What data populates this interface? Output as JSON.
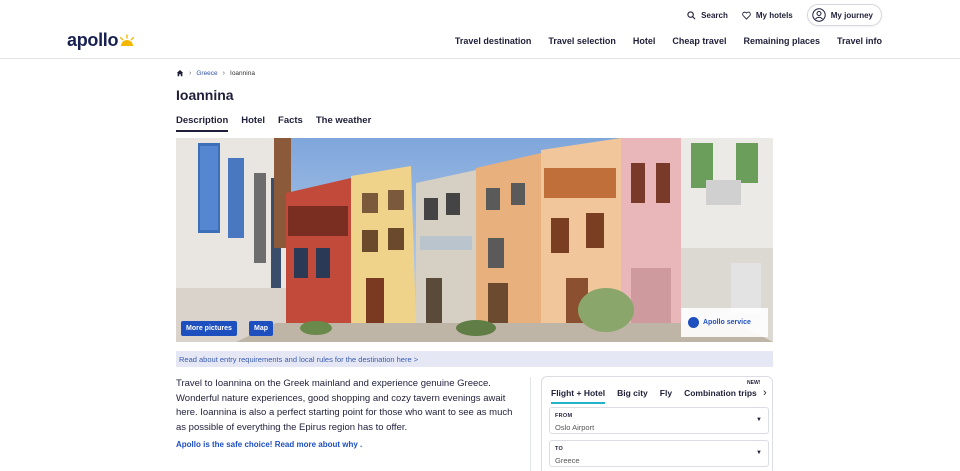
{
  "header": {
    "logo": "apollo",
    "utility": {
      "search": "Search",
      "my_hotels": "My hotels",
      "my_journey": "My journey"
    },
    "nav": [
      "Travel destination",
      "Travel selection",
      "Hotel",
      "Cheap travel",
      "Remaining places",
      "Travel info"
    ]
  },
  "breadcrumb": {
    "parent": "Greece",
    "current": "Ioannina"
  },
  "page_title": "Ioannina",
  "tabs": [
    "Description",
    "Hotel",
    "Facts",
    "The weather"
  ],
  "hero": {
    "more_pictures": "More pictures",
    "map": "Map",
    "service": "Apollo service"
  },
  "entry_banner": "Read about entry requirements and local rules for the destination here >",
  "description": {
    "text": "Travel to Ioannina on the Greek mainland and experience genuine Greece. Wonderful nature experiences, good shopping and cozy tavern evenings await here. Ioannina is also a perfect starting point for those who want to see as much as possible of everything the Epirus region has to offer.",
    "link": "Apollo is the safe choice! Read more about why ."
  },
  "booking": {
    "tabs": [
      "Flight + Hotel",
      "Big city",
      "Fly",
      "Combination trips"
    ],
    "new_tag": "NEW!",
    "from_label": "FROM",
    "from_value": "Oslo Airport",
    "to_label": "TO",
    "to_value": "Greece"
  },
  "colors": {
    "brand_navy": "#172050",
    "link_blue": "#1e4fbf",
    "accent_teal": "#23b3c9",
    "sun_yellow": "#f5b800"
  }
}
